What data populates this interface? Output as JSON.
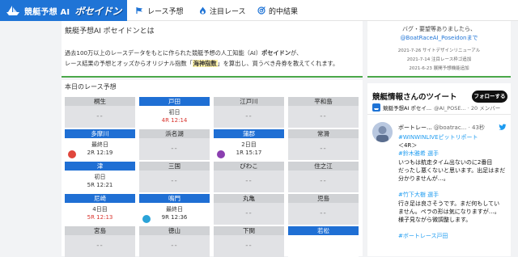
{
  "header": {
    "brand_title": "競艇予想 AI",
    "brand_logo": "ボセイドン",
    "nav": [
      {
        "label": "レース予想"
      },
      {
        "label": "注目レース"
      },
      {
        "label": "的中結果"
      }
    ]
  },
  "intro": {
    "title": "競艇予想AI ポセイドンとは",
    "line1_pre": "過去100万以上のレースデータをもとに作られた競艇予想の人工知能（AI）",
    "line1_bold": "ポセイドン",
    "line1_post": "が、",
    "line2_pre": "レース結果の予想とオッズからオリジナル指数「",
    "line2_hl": "海神指数",
    "line2_post": "」を算出し、買うべき舟券を教えてくれます。"
  },
  "races": {
    "title": "本日のレース予想",
    "cards": [
      {
        "name": "桐生",
        "active": false,
        "l1": "",
        "l2": "",
        "red": false
      },
      {
        "name": "戸田",
        "active": true,
        "l1": "初日",
        "l2": "4R 12:14",
        "red": true
      },
      {
        "name": "江戸川",
        "active": false,
        "l1": "",
        "l2": "",
        "red": false
      },
      {
        "name": "平和島",
        "active": false,
        "l1": "",
        "l2": "",
        "red": false
      },
      {
        "name": "多摩川",
        "active": true,
        "l1": "最終日",
        "l2": "2R 12:19",
        "red": false
      },
      {
        "name": "浜名湖",
        "active": false,
        "l1": "",
        "l2": "",
        "red": false
      },
      {
        "name": "蒲郡",
        "active": true,
        "l1": "2日目",
        "l2": "1R 15:17",
        "red": false
      },
      {
        "name": "常滑",
        "active": false,
        "l1": "",
        "l2": "",
        "red": false
      },
      {
        "name": "津",
        "active": true,
        "l1": "初日",
        "l2": "5R 12:21",
        "red": false
      },
      {
        "name": "三国",
        "active": false,
        "l1": "",
        "l2": "",
        "red": false
      },
      {
        "name": "びわこ",
        "active": false,
        "l1": "",
        "l2": "",
        "red": false
      },
      {
        "name": "住之江",
        "active": false,
        "l1": "",
        "l2": "",
        "red": false
      },
      {
        "name": "尼崎",
        "active": true,
        "l1": "4日目",
        "l2": "5R 12:13",
        "red": true
      },
      {
        "name": "鳴門",
        "active": true,
        "l1": "最終日",
        "l2": "9R 12:36",
        "red": false
      },
      {
        "name": "丸亀",
        "active": false,
        "l1": "",
        "l2": "",
        "red": false
      },
      {
        "name": "児島",
        "active": false,
        "l1": "",
        "l2": "",
        "red": false
      },
      {
        "name": "宮島",
        "active": false,
        "l1": "",
        "l2": "",
        "red": false
      },
      {
        "name": "徳山",
        "active": false,
        "l1": "",
        "l2": "",
        "red": false
      },
      {
        "name": "下関",
        "active": false,
        "l1": "",
        "l2": "",
        "red": false
      },
      {
        "name": "若松",
        "active": true,
        "l1": "",
        "l2": "",
        "red": false
      }
    ],
    "dash": "--"
  },
  "news": {
    "line1": "バグ・要望等ありましたら、",
    "line2": "@BoatRaceAI_Poseidonまで",
    "log1": "2021-7-26 サイトデザインリニューアル",
    "log2": "2021-7-14 注目レース枠ゴ追加",
    "log3": "2021-6-23 展開予想機能追加"
  },
  "twitter": {
    "title": "競艇情報さんのツイート",
    "follow": "フォローする",
    "acct_name": "競艇予想AI ポセイ...",
    "acct_handle": "@AI_POSE... · 20 メンバー",
    "tweet_name": "ボートレー...",
    "tweet_handle": "@boatrac... · 43秒",
    "lines": [
      "#WINWINLIVEピットリポート",
      "＜4R＞",
      "#鈴木雅希 選手",
      "いつもは航走タイム出ないのに2番目",
      "だったし悪くないと思います。出足はまだ",
      "分かりませんが…。",
      "",
      "#竹下大樹 選手",
      "行き足は良さそうです。まだ何もしてい",
      "ません。ペラの形は気になりますが…。",
      "様子見ながら微調整します。",
      "",
      "#ボートレース戸田"
    ]
  },
  "colors": {
    "brand": "#1f74d6",
    "active_head": "#1f6fd4",
    "accent_green": "#4aa84a",
    "red_time": "#d9352f",
    "twitter_blue": "#1d9bf0"
  }
}
